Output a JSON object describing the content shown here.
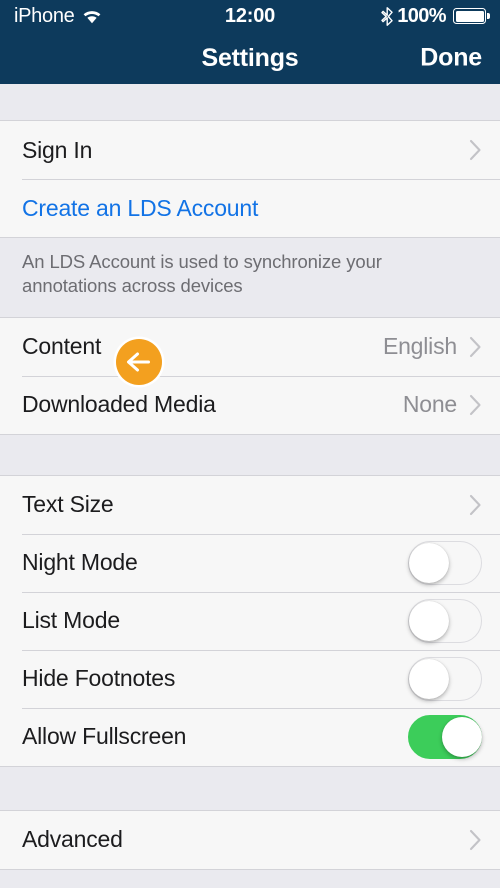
{
  "status_bar": {
    "carrier": "iPhone",
    "wifi_icon": "wifi-icon",
    "time": "12:00",
    "bluetooth_icon": "bluetooth-icon",
    "battery_percent": "100%",
    "battery_icon": "battery-full-icon"
  },
  "nav_bar": {
    "title": "Settings",
    "right_button": "Done"
  },
  "colors": {
    "navbar_background": "#0d3a5c",
    "row_background": "#f7f7f7",
    "group_background": "#eaeaef",
    "separator": "#d3d3d8",
    "link_blue": "#1273e6",
    "value_gray": "#8e8e93",
    "switch_on_green": "#3ccd5a",
    "cursor_orange": "#f3a01f"
  },
  "sections": [
    {
      "id": "account",
      "rows": [
        {
          "label": "Sign In",
          "type": "disclosure",
          "value": ""
        },
        {
          "label": "Create an LDS Account",
          "type": "link",
          "value": ""
        }
      ],
      "footer": "An LDS Account is used to synchronize your annotations across devices"
    },
    {
      "id": "content",
      "rows": [
        {
          "label": "Content",
          "type": "value-disclosure",
          "value": "English"
        },
        {
          "label": "Downloaded Media",
          "type": "value-disclosure",
          "value": "None"
        }
      ],
      "footer": ""
    },
    {
      "id": "display",
      "rows": [
        {
          "label": "Text Size",
          "type": "disclosure",
          "value": ""
        },
        {
          "label": "Night Mode",
          "type": "switch",
          "value": "off"
        },
        {
          "label": "List Mode",
          "type": "switch",
          "value": "off"
        },
        {
          "label": "Hide Footnotes",
          "type": "switch",
          "value": "off"
        },
        {
          "label": "Allow Fullscreen",
          "type": "switch",
          "value": "on"
        }
      ],
      "footer": ""
    },
    {
      "id": "advanced",
      "rows": [
        {
          "label": "Advanced",
          "type": "disclosure",
          "value": ""
        }
      ],
      "footer": ""
    }
  ],
  "cursor": {
    "icon": "arrow-left-icon",
    "label": "pointer-overlay"
  }
}
